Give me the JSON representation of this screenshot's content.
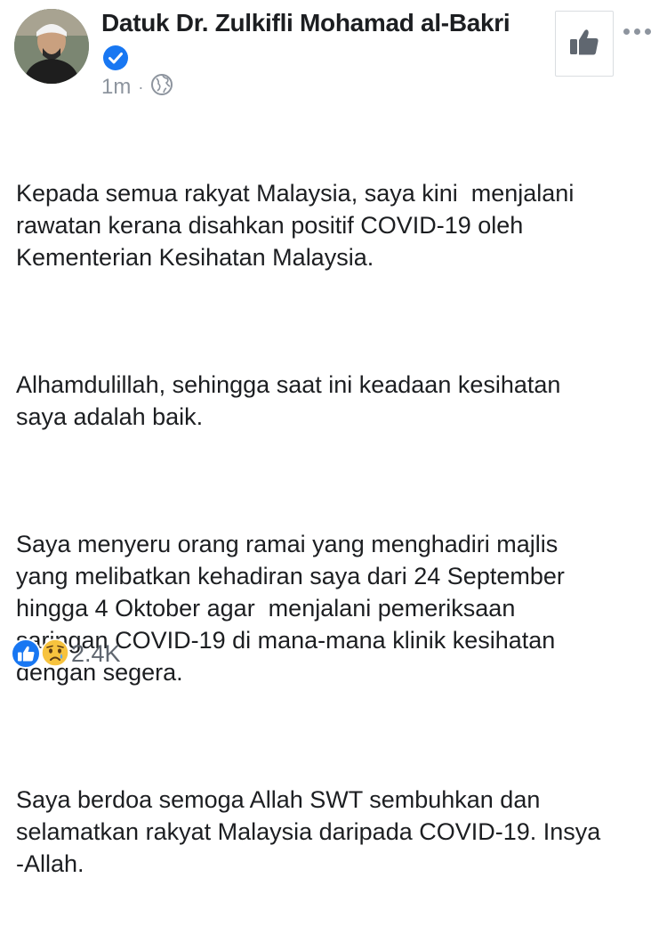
{
  "post": {
    "author": "Datuk Dr. Zulkifli Mohamad al-Bakri",
    "timestamp": "1m",
    "separator": "·",
    "paragraphs": [
      "Kepada semua rakyat Malaysia, saya kini  menjalani\nrawatan kerana disahkan positif COVID-19 oleh\nKementerian Kesihatan Malaysia.",
      "Alhamdulillah, sehingga saat ini keadaan kesihatan\nsaya adalah baik.",
      "Saya menyeru orang ramai yang menghadiri majlis\nyang melibatkan kehadiran saya dari 24 September\nhingga 4 Oktober agar  menjalani pemeriksaan\nsaringan COVID-19 di mana-mana klinik kesihatan\ndengan segera.",
      "Saya berdoa semoga Allah SWT sembuhkan dan\nselamatkan rakyat Malaysia daripada COVID-19. Insya\n-Allah."
    ],
    "reaction_count": "2.4K"
  },
  "icons": {
    "avatar": "avatar",
    "verified": "verified-badge-icon",
    "privacy": "globe-icon",
    "like_button": "thumbs-up-icon",
    "more": "more-options-icon",
    "reactions": [
      "like-reaction-icon",
      "sad-reaction-icon"
    ]
  },
  "colors": {
    "verified_blue": "#1877f2",
    "text": "#1c1e21",
    "meta_gray": "#8d949e",
    "like_blue": "#1877f2",
    "sad_yellow": "#f7c33e"
  }
}
